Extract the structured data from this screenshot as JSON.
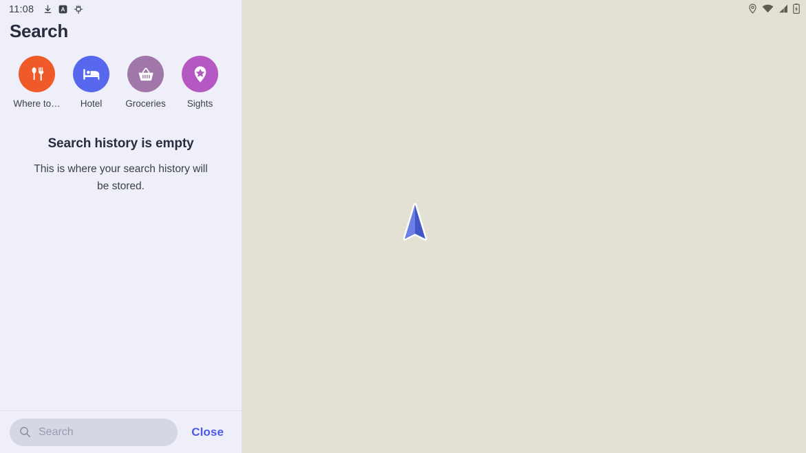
{
  "status_bar": {
    "time": "11:08",
    "icons": [
      "download-icon",
      "letter-a-badge-icon",
      "bug-icon"
    ]
  },
  "sidebar": {
    "title": "Search",
    "categories": [
      {
        "label": "Where to…",
        "icon": "restaurant-icon",
        "color": "#F05A28"
      },
      {
        "label": "Hotel",
        "icon": "bed-icon",
        "color": "#5868EE"
      },
      {
        "label": "Groceries",
        "icon": "shopping-basket-icon",
        "color": "#A077A8"
      },
      {
        "label": "Sights",
        "icon": "star-pin-icon",
        "color": "#B558C4"
      }
    ],
    "empty_state": {
      "title": "Search history is empty",
      "subtitle": "This is where your search history will be stored."
    },
    "search": {
      "value": "",
      "placeholder": "Search",
      "icon": "search-icon"
    },
    "close_label": "Close"
  },
  "map": {
    "background_color": "#E3E1D3",
    "status_icons": [
      "location-pin-icon",
      "wifi-icon",
      "cellular-signal-icon",
      "battery-charging-icon"
    ],
    "position_marker": "navigation-arrow"
  },
  "colors": {
    "sidebar_bg": "#EFEFF9",
    "map_bg": "#E3E1D3",
    "accent": "#4A5BE8",
    "search_pill": "#D6D7E5",
    "text_primary": "#2B2B40",
    "text_secondary": "#3C4043"
  }
}
